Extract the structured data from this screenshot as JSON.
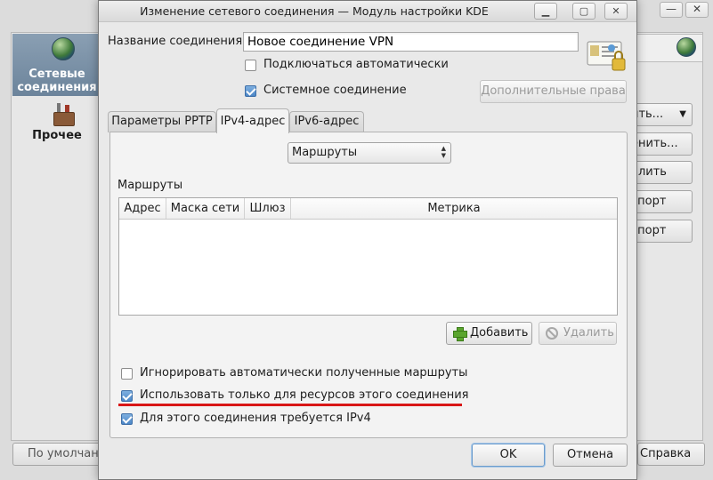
{
  "background": {
    "sidebar": [
      {
        "label": "Сетевые\nсоединения",
        "selected": true
      },
      {
        "label": "Прочее",
        "selected": false
      }
    ],
    "buttons": [
      "ить...",
      "енить...",
      "алить",
      "спорт",
      "спорт"
    ],
    "bottom_left": "По умолчанию",
    "bottom_right": "Справка"
  },
  "dialog": {
    "title": "Изменение сетевого соединения — Модуль настройки KDE",
    "connection_name_label": "Название соединения:",
    "connection_name_value": "Новое соединение VPN",
    "auto_connect_label": "Подключаться автоматически",
    "auto_connect_checked": false,
    "system_connection_label": "Системное соединение",
    "system_connection_checked": true,
    "extra_rights_button": "Дополнительные права",
    "tabs": [
      {
        "label": "Параметры PPTP",
        "active": false
      },
      {
        "label": "IPv4-адрес",
        "active": true
      },
      {
        "label": "IPv6-адрес",
        "active": false
      }
    ],
    "method_combo": "Маршруты",
    "routes_label": "Маршруты",
    "routes_table": {
      "columns": [
        "Адрес",
        "Маска сети",
        "Шлюз",
        "Метрика"
      ],
      "rows": []
    },
    "add_button": "Добавить",
    "remove_button": "Удалить",
    "ignore_routes_label": "Игнорировать автоматически полученные маршруты",
    "ignore_routes_checked": false,
    "only_resources_label": "Использовать только для ресурсов этого соединения",
    "only_resources_checked": true,
    "require_ipv4_label": "Для этого соединения требуется IPv4",
    "require_ipv4_checked": true,
    "ok_button": "OK",
    "cancel_button": "Отмена"
  },
  "colors": {
    "accent": "#4c86c6",
    "highlight_line": "#d81616",
    "selected_sidebar": "#7a90a6"
  }
}
